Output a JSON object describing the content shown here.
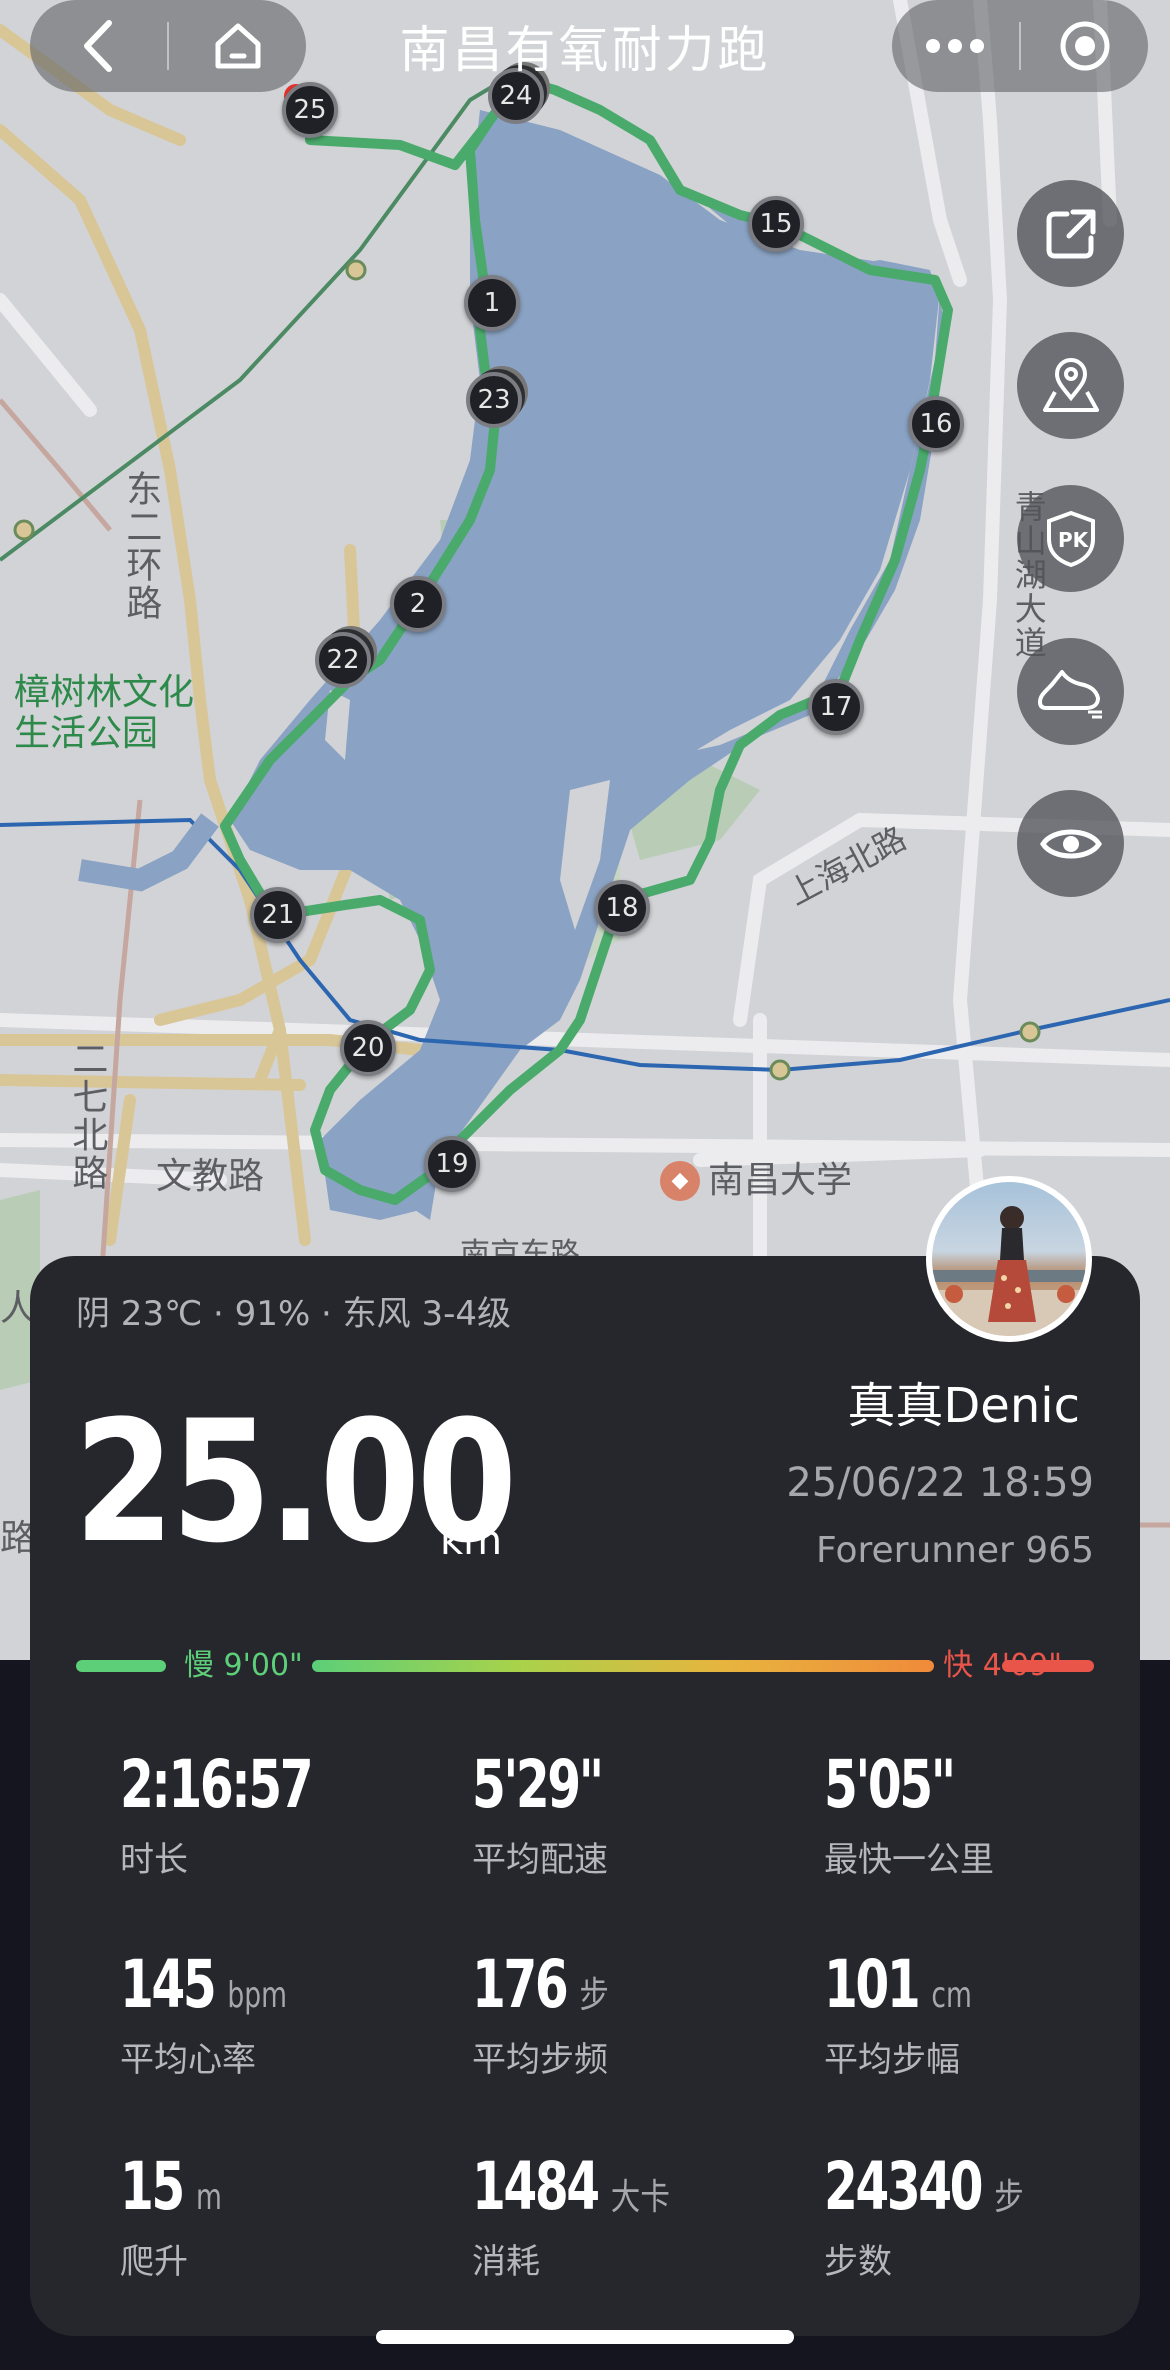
{
  "header": {
    "title": "南昌有氧耐力跑",
    "back_icon": "chevron-left-icon",
    "home_icon": "home-icon",
    "more_icon": "more-dots-icon",
    "close_icon": "target-circle-icon"
  },
  "side_buttons": [
    {
      "name": "share-button",
      "icon": "share-icon"
    },
    {
      "name": "route-location-button",
      "icon": "map-pin-icon"
    },
    {
      "name": "pk-button",
      "icon": "pk-shield-icon"
    },
    {
      "name": "shoe-button",
      "icon": "running-shoe-icon"
    },
    {
      "name": "visibility-button",
      "icon": "eye-icon"
    }
  ],
  "map": {
    "labels": {
      "dongyi_road": "东二环路",
      "park": "樟树林文化\n生活公园",
      "shanghai_road": "上海北路",
      "erqi_road": "二七北路",
      "wenjiao_road": "文教路",
      "university": "南昌大学",
      "qingshanhu": "青山湖大道",
      "cut_left1": "人民",
      "cut_left2": "路",
      "cut_bottom": "南京东路"
    },
    "km_markers": [
      "1",
      "2",
      "15",
      "16",
      "17",
      "18",
      "19",
      "20",
      "21",
      "22",
      "23",
      "24",
      "25"
    ],
    "colors": {
      "route": "#4aaa6c",
      "lake": "#8aa2c3",
      "metro": "#2c66b0"
    }
  },
  "summary": {
    "weather": "阴 23℃ · 91% · 东风 3-4级",
    "username": "真真Denic",
    "datetime": "25/06/22 18:59",
    "device": "Forerunner 965",
    "distance": "25.00",
    "distance_unit": "km"
  },
  "pace_bar": {
    "slow_label": "慢 9'00\"",
    "fast_label": "快 4'09\"",
    "colors": {
      "slow": "#5ccf78",
      "fast": "#ea5549"
    }
  },
  "stats": [
    {
      "value": "2:16:57",
      "unit": "",
      "label": "时长"
    },
    {
      "value": "5'29\"",
      "unit": "",
      "label": "平均配速"
    },
    {
      "value": "5'05\"",
      "unit": "",
      "label": "最快一公里"
    },
    {
      "value": "145",
      "unit": "bpm",
      "label": "平均心率"
    },
    {
      "value": "176",
      "unit": "步",
      "label": "平均步频"
    },
    {
      "value": "101",
      "unit": "cm",
      "label": "平均步幅"
    },
    {
      "value": "15",
      "unit": "m",
      "label": "爬升"
    },
    {
      "value": "1484",
      "unit": "大卡",
      "label": "消耗"
    },
    {
      "value": "24340",
      "unit": "步",
      "label": "步数"
    }
  ]
}
